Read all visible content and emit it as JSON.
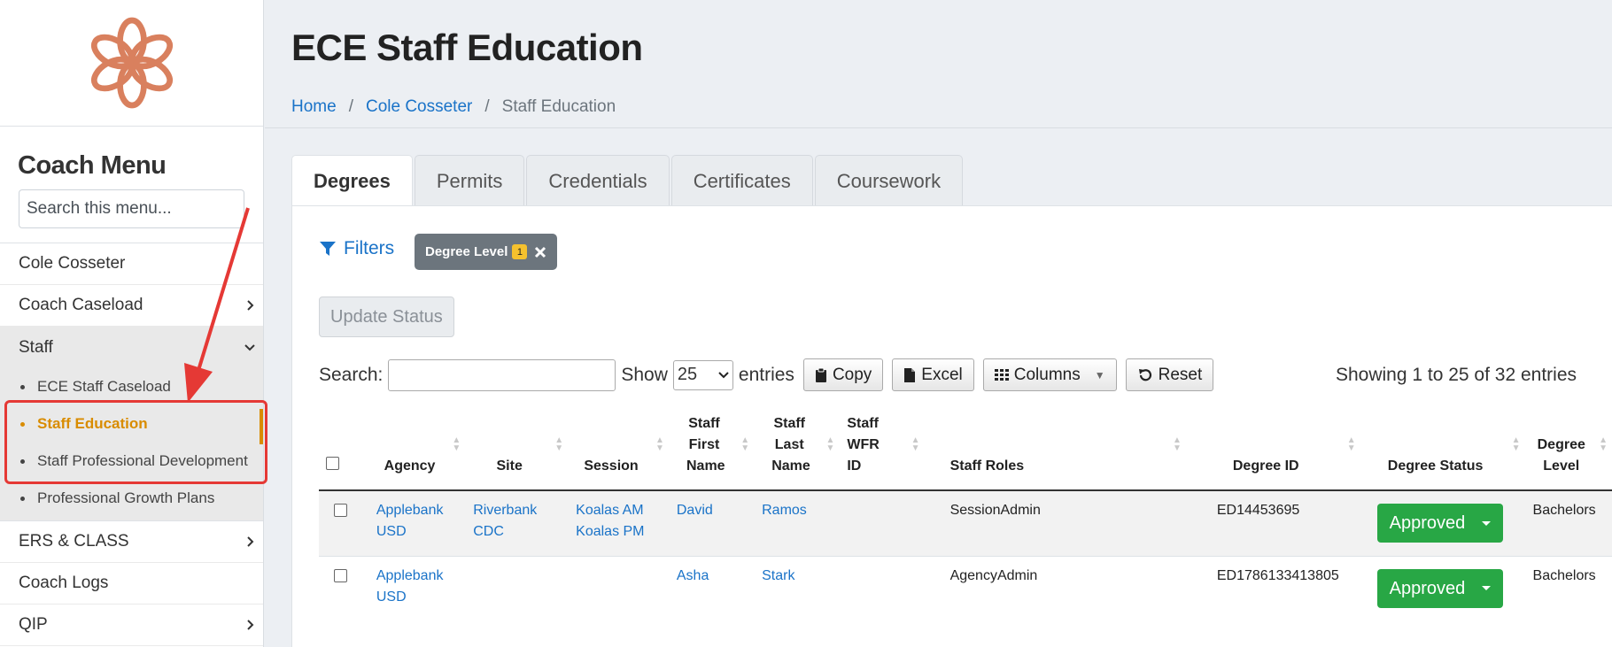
{
  "sidebar": {
    "menu_title": "Coach Menu",
    "search_placeholder": "Search this menu...",
    "items": [
      {
        "label": "Cole Cosseter"
      },
      {
        "label": "Coach Caseload"
      },
      {
        "label": "Staff"
      },
      {
        "label": "ERS & CLASS"
      },
      {
        "label": "Coach Logs"
      },
      {
        "label": "QIP"
      }
    ],
    "staff_submenu": [
      {
        "label": "ECE Staff Caseload"
      },
      {
        "label": "Staff Education"
      },
      {
        "label": "Staff Professional Development"
      },
      {
        "label": "Professional Growth Plans"
      }
    ]
  },
  "header": {
    "title": "ECE Staff Education",
    "breadcrumb": [
      "Home",
      "Cole Cosseter",
      "Staff Education"
    ]
  },
  "tabs": [
    "Degrees",
    "Permits",
    "Credentials",
    "Certificates",
    "Coursework"
  ],
  "filters": {
    "label": "Filters",
    "chip_label": "Degree Level",
    "chip_count": "1"
  },
  "update_status_label": "Update Status",
  "toolbar": {
    "search_label": "Search:",
    "show_label": "Show",
    "show_value": "25",
    "entries_label": "entries",
    "copy_label": "Copy",
    "excel_label": "Excel",
    "columns_label": "Columns",
    "reset_label": "Reset",
    "info": "Showing 1 to 25 of 32 entries"
  },
  "table": {
    "headers": [
      "Agency",
      "Site",
      "Session",
      "Staff First Name",
      "Staff Last Name",
      "Staff WFR ID",
      "Staff Roles",
      "Degree ID",
      "Degree Status",
      "Degree Level"
    ],
    "rows": [
      {
        "agency": "Applebank USD",
        "site": "Riverbank CDC",
        "session1": "Koalas AM",
        "session2": "Koalas PM",
        "first": "David",
        "last": "Ramos",
        "wfr": "",
        "roles": "SessionAdmin",
        "degree_id": "ED14453695",
        "status": "Approved",
        "level": "Bachelors"
      },
      {
        "agency": "Applebank USD",
        "site": "",
        "session1": "",
        "session2": "",
        "first": "Asha",
        "last": "Stark",
        "wfr": "",
        "roles": "AgencyAdmin",
        "degree_id": "ED1786133413805",
        "status": "Approved",
        "level": "Bachelors"
      }
    ]
  },
  "colors": {
    "accent": "#1a73c8",
    "active_menu": "#d98c00",
    "approved": "#28a745",
    "logo": "#d9805e",
    "annotation": "#e53935"
  }
}
